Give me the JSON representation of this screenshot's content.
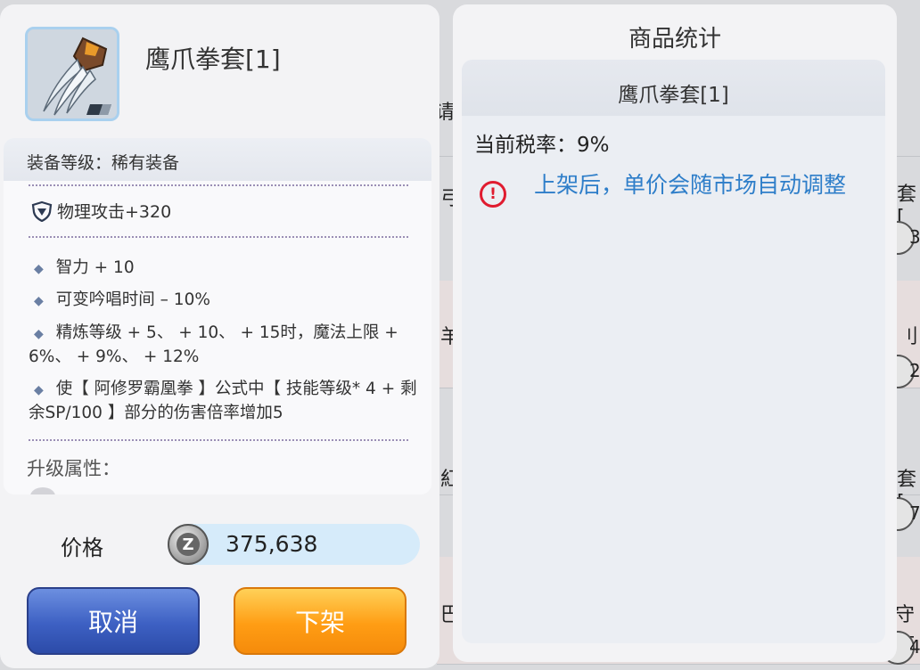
{
  "item": {
    "name": "鹰爪拳套[1]",
    "icon": "claw-gloves-icon"
  },
  "details": {
    "grade": "装备等级：稀有装备",
    "physical_attack": "物理攻击+320",
    "stats": [
      "智力 + 10",
      "可变吟唱时间 – 10%",
      "精炼等级 + 5、 + 10、 + 15时，魔法上限 + 6%、 + 9%、 + 12%",
      "使【 阿修罗霸凰拳 】公式中【 技能等级* 4 + 剩余SP/100 】部分的伤害倍率增加5"
    ],
    "upgrade_label": "升级属性："
  },
  "price": {
    "label": "价格",
    "currency_icon": "zeny-coin-icon",
    "currency_glyph": "Z",
    "value": "375,638"
  },
  "buttons": {
    "cancel": "取消",
    "delist": "下架"
  },
  "stats_panel": {
    "title": "商品统计",
    "item_name": "鹰爪拳套[1]",
    "tax": "当前税率：9%",
    "notice": "上架后，单价会随市场自动调整",
    "warning_glyph": "!"
  },
  "background": {
    "fragments": [
      "请",
      "套[",
      "3",
      "2",
      "7",
      "4",
      "刂",
      "套[",
      "守文",
      "羊",
      "紅",
      "巴",
      "弓"
    ]
  },
  "colors": {
    "notice": "#2e7ec9",
    "cancel_button": "#3d60c3",
    "delist_button": "#ff9d14",
    "warning": "#e01b2f"
  }
}
